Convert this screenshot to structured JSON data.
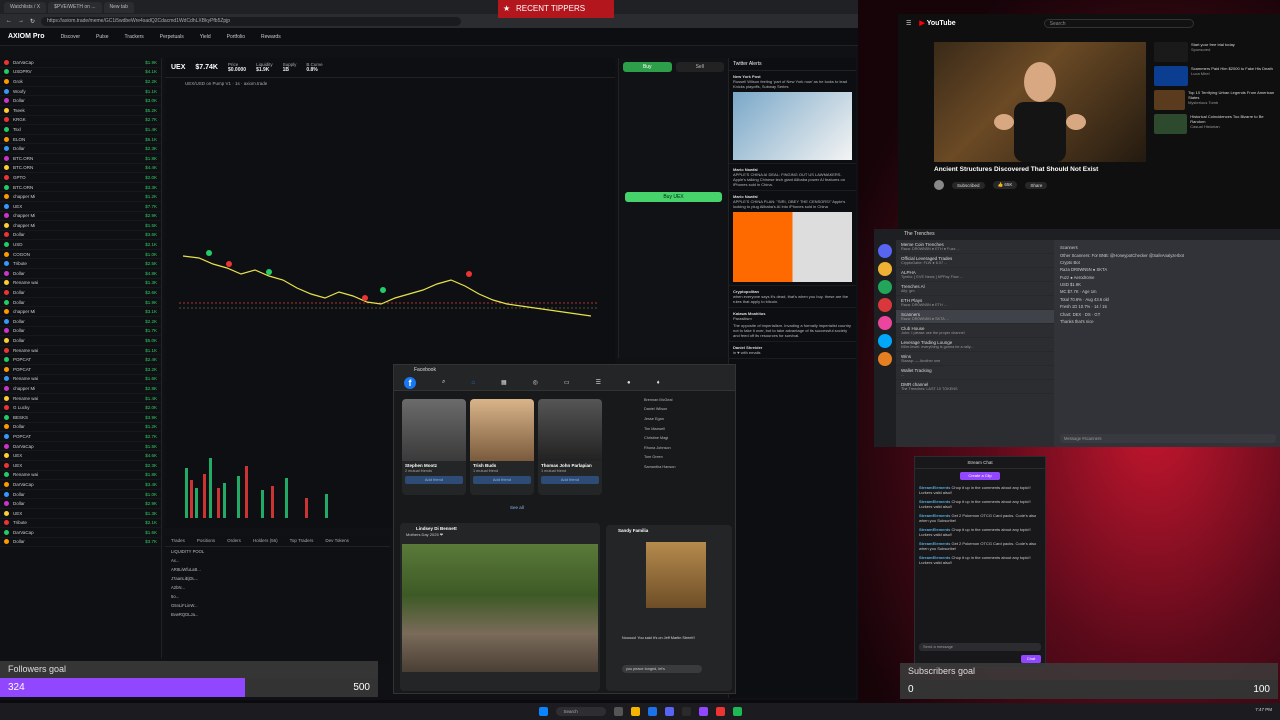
{
  "browser": {
    "tabs": [
      "Watchlists / X",
      "$PVE/WETH on ...",
      "New tab"
    ],
    "url": "https://axiom.trade/meme/GC1i5wdbeWre4sadQ2Cdacmd1WdCdhLXBkyPfb5Zpjp"
  },
  "axiom": {
    "logo": "AXIOM Pro",
    "nav": [
      "Discover",
      "Pulse",
      "Trackers",
      "Perpetuals",
      "Yield",
      "Portfolio",
      "Rewards"
    ],
    "token": "UEX",
    "price": "$7.74K",
    "stats": [
      {
        "label": "Price",
        "value": "$0.0000"
      },
      {
        "label": "Liquidity",
        "value": "$1.9K"
      },
      {
        "label": "Supply",
        "value": "1B"
      },
      {
        "label": "B.Curve",
        "value": "0.8%"
      }
    ],
    "chart_caption": "UEX/USD on Pump V1 · 1s · axiom.trade",
    "buy_label": "Buy",
    "sell_label": "Sell",
    "buy_button": "Buy UEX",
    "watchlist": [
      {
        "name": "DarVaCap",
        "v": "$1.9K"
      },
      {
        "name": "USDPRV",
        "v": "$4.1K"
      },
      {
        "name": "Grok",
        "v": "$2.2K"
      },
      {
        "name": "Woofy",
        "v": "$1.1K"
      },
      {
        "name": "Dollar",
        "v": "$3.0K"
      },
      {
        "name": "Tseek",
        "v": "$5.2K"
      },
      {
        "name": "KRGK",
        "v": "$2.7K"
      },
      {
        "name": "Tsxl",
        "v": "$1.4K"
      },
      {
        "name": "ELON",
        "v": "$6.1K"
      },
      {
        "name": "Dollar",
        "v": "$2.3K"
      },
      {
        "name": "BTC.ORN",
        "v": "$1.8K"
      },
      {
        "name": "BTC.ORN",
        "v": "$4.4K"
      },
      {
        "name": "GPTO",
        "v": "$2.0K"
      },
      {
        "name": "BTC.ORN",
        "v": "$3.3K"
      },
      {
        "name": "chapper Mi",
        "v": "$1.2K"
      },
      {
        "name": "UEX",
        "v": "$7.7K"
      },
      {
        "name": "chapper Mi",
        "v": "$2.9K"
      },
      {
        "name": "chapper Mi",
        "v": "$1.5K"
      },
      {
        "name": "Dollar",
        "v": "$3.6K"
      },
      {
        "name": "USD",
        "v": "$2.1K"
      },
      {
        "name": "COGON",
        "v": "$1.0K"
      },
      {
        "name": "Tribute",
        "v": "$2.5K"
      },
      {
        "name": "Dollar",
        "v": "$4.8K"
      },
      {
        "name": "Rename wai",
        "v": "$1.3K"
      },
      {
        "name": "Dollar",
        "v": "$2.6K"
      },
      {
        "name": "Dollar",
        "v": "$1.9K"
      },
      {
        "name": "chapper Mi",
        "v": "$3.1K"
      },
      {
        "name": "Dollar",
        "v": "$2.2K"
      },
      {
        "name": "Dollar",
        "v": "$1.7K"
      },
      {
        "name": "Dollar",
        "v": "$5.0K"
      },
      {
        "name": "Rename wai",
        "v": "$1.1K"
      },
      {
        "name": "POPCAT",
        "v": "$2.4K"
      },
      {
        "name": "POPCAT",
        "v": "$3.2K"
      },
      {
        "name": "Rename wai",
        "v": "$1.6K"
      },
      {
        "name": "chapper Mi",
        "v": "$2.8K"
      },
      {
        "name": "Rename wai",
        "v": "$1.4K"
      },
      {
        "name": "G Lucky",
        "v": "$2.0K"
      },
      {
        "name": "BESKS",
        "v": "$3.9K"
      },
      {
        "name": "Dollar",
        "v": "$1.2K"
      },
      {
        "name": "POPCAT",
        "v": "$2.7K"
      },
      {
        "name": "DarVaCap",
        "v": "$1.5K"
      },
      {
        "name": "UEX",
        "v": "$4.6K"
      },
      {
        "name": "UEX",
        "v": "$2.3K"
      },
      {
        "name": "Rename wai",
        "v": "$1.8K"
      },
      {
        "name": "DarVaCap",
        "v": "$3.4K"
      },
      {
        "name": "Dollar",
        "v": "$1.0K"
      },
      {
        "name": "Dollar",
        "v": "$2.9K"
      },
      {
        "name": "UEX",
        "v": "$1.3K"
      },
      {
        "name": "Tribute",
        "v": "$2.1K"
      },
      {
        "name": "DarVaCap",
        "v": "$1.6K"
      },
      {
        "name": "Dollar",
        "v": "$3.7K"
      }
    ],
    "bottom_tabs": [
      "Trades",
      "Positions",
      "Orders",
      "Holders (56)",
      "Top Traders",
      "Dev Tokens"
    ],
    "holders": [
      "LIQUIDITY POOL",
      "Ax...",
      "AR8LiWfuLaB...",
      "J7aanLiEjDL...",
      "A2bN...",
      "5o...",
      "G5nLiFLinW...",
      "BvwRQDLJa..."
    ],
    "news_title": "Twitter Alerts",
    "news": [
      {
        "src": "New York Post",
        "text": "Russell Wilson feeling 'part of New York now' as he looks to lead Knicks playoffs, Subway Series"
      },
      {
        "src": "Mario Nawfal",
        "text": "APPLE'S CHINA AI DEAL: FINGING OUT US LAWMAKERS. Apple's talking Chinese tech giant Alibaba power AI features on iPhones sold in China."
      },
      {
        "src": "Mario Nawfal",
        "text": "APPLE'S CHINA PLAN: \"SIRI, OBEY THE CENSORS!\" Apple's looking to plug Alibaba's AI into iPhones sold in China"
      },
      {
        "src": "Cryptopolitan",
        "text": "when everyone says it's dead, that's when you buy. these are the rules that apply to bitcoin."
      },
      {
        "src": "Kalawa Moahitus",
        "text": "Parasitism"
      },
      {
        "src": "Daniel Shreider",
        "text": "in ♥ with emails"
      }
    ],
    "parasitism_body": "The opposite of imperialism. Invading a formally imperialist country not to take it over, but to take advantage of its successful society and feed off its resources for survival."
  },
  "tippers": {
    "label": "RECENT TIPPERS"
  },
  "facebook": {
    "title": "Facebook",
    "people": [
      {
        "name": "Stephen Mootz",
        "mutual": "2 mutual friends",
        "add": "Add friend"
      },
      {
        "name": "Trish Buds",
        "mutual": "1 mutual friend",
        "add": "Add friend"
      },
      {
        "name": "Thomas John Parlapian",
        "mutual": "1 mutual friend",
        "add": "Add friend"
      }
    ],
    "see_all": "See all",
    "post_author": "Lindsey Di Bennett",
    "post_sub": "Mothers Day 2025 ❤",
    "contacts": [
      "Brennan McGeal",
      "Daniel Wilson",
      "Jesse Egan",
      "Tim Maxwell",
      "Christine Magi",
      "Rhona Johnson",
      "Tom Green",
      "Samantha Hanson"
    ],
    "chat_name": "Sandy Familia",
    "chat_msg": "Nooooo! You said it's on Jeff Martin Street!!",
    "chat_input": "you peace tonged, let's"
  },
  "youtube": {
    "logo": "YouTube",
    "search": "Search",
    "title": "Ancient Structures Discovered That Should Not Exist",
    "subscribe": "Subscribed",
    "likes": "65K",
    "share": "Share",
    "sidebar": [
      {
        "title": "Start your free trial today",
        "sub": "Sponsored"
      },
      {
        "title": "Scammers Paid Him $2000 to Fake His Death",
        "sub": "Luca Mirel"
      },
      {
        "title": "Top 10 Terrifying Urban Legends From American States",
        "sub": "Mysterious Tomb"
      },
      {
        "title": "Historical Coincidences Too Bizarre to Be Random",
        "sub": "Casual Historian"
      }
    ]
  },
  "discord": {
    "title": "The Trenches",
    "channels": [
      {
        "name": "Meme Coin Trenches",
        "sub": "Raza: DR0WN5N ● ETH ● Fuzz ..."
      },
      {
        "name": "Official Leveraged Trades",
        "sub": "CryptoGabe: FLW ● 8.07 ..."
      },
      {
        "name": "ALPHA",
        "sub": "Tyrelio: [ EVE News ] NPPay Flow ..."
      },
      {
        "name": "Trenches Al",
        "sub": "Ally: gm"
      },
      {
        "name": "ETH Plays",
        "sub": "Raza: DR0WN5N ● ETH ..."
      },
      {
        "name": "Scanners",
        "sub": "Raza: DR0WN5N ● SKTA ..."
      },
      {
        "name": "Club House",
        "sub": "John: I please use the proper channel"
      },
      {
        "name": "Leverage Trading Lounge",
        "sub": "KillerJewel: everything is gonna be a rally..."
      },
      {
        "name": "Wins",
        "sub": "Slaaap: — Another one"
      },
      {
        "name": "Wallet Tracking",
        "sub": "..."
      },
      {
        "name": "DMR channel",
        "sub": "The Trenches: LAST 10 TOKENS"
      }
    ],
    "msgs": [
      "Scanners",
      "Other Scanners: For BNB: @HoneypotChecker @SafeAnalyzerbot",
      "Crypto Bot",
      "Raza DR0WN5N ● SKTA",
      "Fuzz ● Aerodrome",
      "USD $1.9K",
      "MC $7.7K · Age 1m",
      "Total 70.6% · Aug 43.6 old",
      "Fresh 1D 10.7% · 14 / 15",
      "Chart: DEX · DS · GT",
      "Thanks that's nice",
      "Message #scanners"
    ]
  },
  "twitch": {
    "header": "Stream Chat",
    "clip_btn": "Create a Clip",
    "messages": [
      {
        "user": "StreamElements",
        "text": "Chop it up in the comments about any topic!! Lurkers valid also!!"
      },
      {
        "user": "StreamElements",
        "text": "Chop it up in the comments about any topic!! Lurkers valid also!!"
      },
      {
        "user": "StreamElements",
        "text": "Get 2 Pokemon OTCG Card packs. Code's also when you Subscribe!"
      },
      {
        "user": "StreamElements",
        "text": "Chop it up in the comments about any topic!! Lurkers valid also!!"
      },
      {
        "user": "StreamElements",
        "text": "Get 2 Pokemon OTCG Card packs. Code's also when you Subscribe!"
      },
      {
        "user": "StreamElements",
        "text": "Chop it up in the comments about any topic!! Lurkers valid also!!"
      }
    ],
    "input": "Send a message",
    "chat_btn": "Chat"
  },
  "goals": {
    "followers": {
      "label": "Followers goal",
      "current": "324",
      "target": "500",
      "fraction": 0.648
    },
    "subscribers": {
      "label": "Subscribers goal",
      "current": "0",
      "target": "100",
      "fraction": 0.0
    }
  },
  "taskbar": {
    "search": "Search",
    "time": "7:47 PM"
  }
}
